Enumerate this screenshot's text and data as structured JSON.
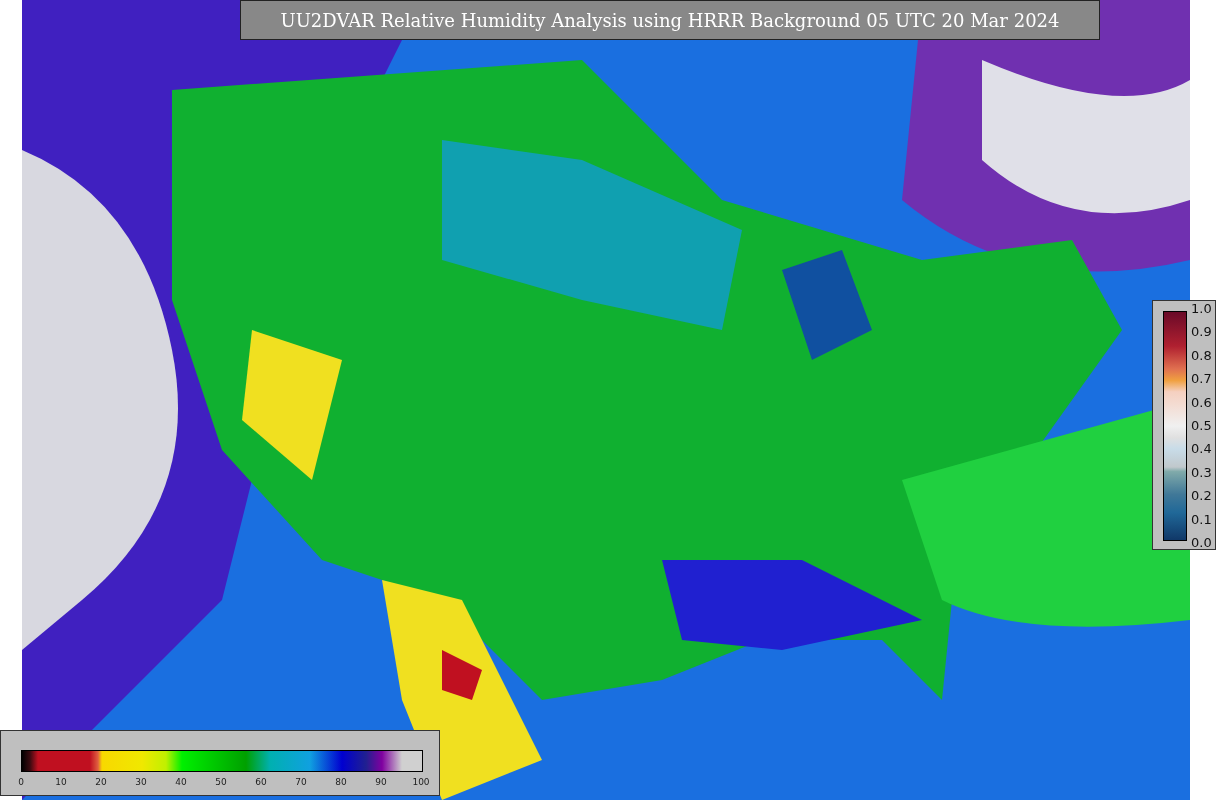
{
  "title": "UU2DVAR Relative Humidity Analysis using HRRR Background 05 UTC 20 Mar 2024",
  "colorbar_horizontal": {
    "ticks": [
      "0",
      "10",
      "20",
      "30",
      "40",
      "50",
      "60",
      "70",
      "80",
      "90",
      "100"
    ]
  },
  "colorbar_vertical": {
    "ticks": [
      "1.0",
      "0.9",
      "0.8",
      "0.7",
      "0.6",
      "0.5",
      "0.4",
      "0.3",
      "0.2",
      "0.1",
      "0.0"
    ]
  }
}
